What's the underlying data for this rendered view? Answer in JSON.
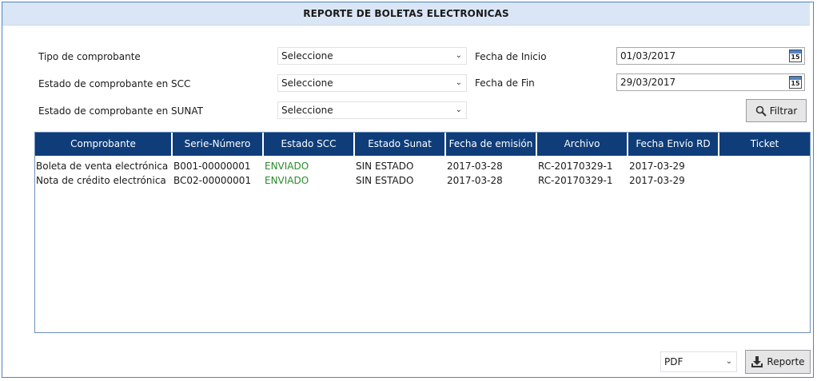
{
  "title": "REPORTE DE BOLETAS ELECTRONICAS",
  "filters": {
    "tipo_label": "Tipo de comprobante",
    "tipo_value": "Seleccione",
    "estado_scc_label": "Estado de comprobante en SCC",
    "estado_scc_value": "Seleccione",
    "estado_sunat_label": "Estado de comprobante en SUNAT",
    "estado_sunat_value": "Seleccione",
    "fecha_inicio_label": "Fecha de Inicio",
    "fecha_inicio_value": "01/03/2017",
    "fecha_fin_label": "Fecha de Fin",
    "fecha_fin_value": "29/03/2017",
    "calendar_day": "15",
    "filtrar_label": "Filtrar"
  },
  "table": {
    "columns": [
      "Comprobante",
      "Serie-Número",
      "Estado SCC",
      "Estado Sunat",
      "Fecha de emisión",
      "Archivo",
      "Fecha Envío RD",
      "Ticket"
    ],
    "rows": [
      [
        "Boleta de venta electrónica",
        "B001-00000001",
        "ENVIADO",
        "SIN ESTADO",
        "2017-03-28",
        "RC-20170329-1",
        "2017-03-29",
        ""
      ],
      [
        "Nota de crédito electrónica",
        "BC02-00000001",
        "ENVIADO",
        "SIN ESTADO",
        "2017-03-28",
        "RC-20170329-1",
        "2017-03-29",
        ""
      ]
    ]
  },
  "footer": {
    "format_value": "PDF",
    "reporte_label": "Reporte"
  },
  "colors": {
    "header_bg": "#0f3d7a",
    "title_bg": "#dae6f5",
    "status_green": "#2a8a2a"
  }
}
